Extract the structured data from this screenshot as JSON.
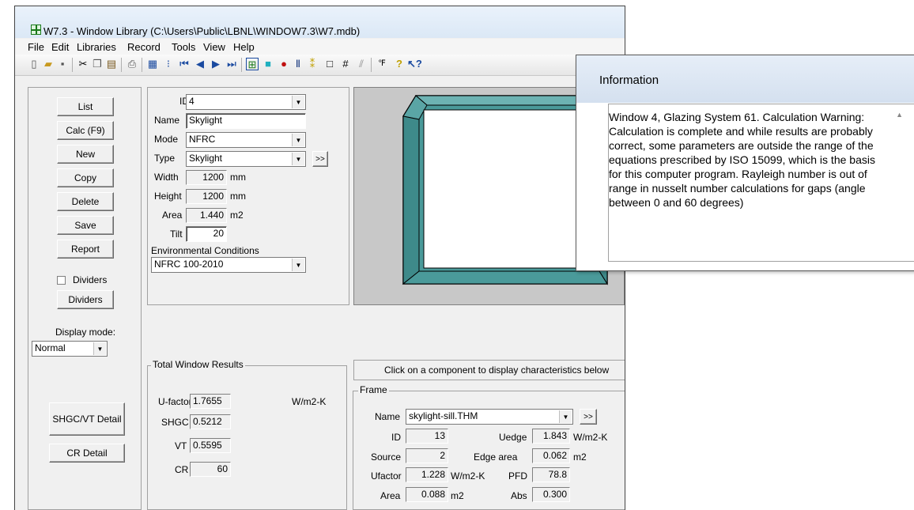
{
  "app": {
    "title": "W7.3 - Window Library (C:\\Users\\Public\\LBNL\\WINDOW7.3\\W7.mdb)",
    "menu": [
      "File",
      "Edit",
      "Libraries",
      "Record",
      "Tools",
      "View",
      "Help"
    ]
  },
  "toolbar": {
    "icons": [
      "new-file-icon",
      "open-folder-icon",
      "save-disk-icon",
      "cut-icon",
      "copy-icon",
      "paste-icon",
      "print-icon",
      "grid-view-icon",
      "list-view-icon",
      "first-record-icon",
      "previous-record-icon",
      "next-record-icon",
      "last-record-icon",
      "window-icon",
      "glazing-icon",
      "gas-icon",
      "frame-icon",
      "spacer-icon",
      "divider-icon",
      "grid-icon",
      "shading-icon",
      "units-icon",
      "help-icon",
      "context-help-icon"
    ]
  },
  "buttons": {
    "list": "List",
    "calc": "Calc (F9)",
    "new": "New",
    "copy": "Copy",
    "delete": "Delete",
    "save": "Save",
    "report": "Report",
    "dividers_check": "Dividers",
    "dividers": "Dividers",
    "shgc_vt_detail": "SHGC/VT Detail",
    "cr_detail": "CR Detail",
    "type_more": ">>",
    "frame_more": ">>"
  },
  "display_mode": {
    "label": "Display mode:",
    "value": "Normal"
  },
  "record": {
    "id_label": "ID #",
    "id": "4",
    "name_label": "Name",
    "name": "Skylight",
    "mode_label": "Mode",
    "mode": "NFRC",
    "type_label": "Type",
    "type": "Skylight",
    "width_label": "Width",
    "width": "1200",
    "width_unit": "mm",
    "height_label": "Height",
    "height": "1200",
    "height_unit": "mm",
    "area_label": "Area",
    "area": "1.440",
    "area_unit": "m2",
    "tilt_label": "Tilt",
    "tilt": "20",
    "env_label": "Environmental Conditions",
    "env": "NFRC 100-2010"
  },
  "results": {
    "title": "Total Window Results",
    "ufactor_label": "U-factor",
    "ufactor": "1.7655",
    "ufactor_unit": "W/m2-K",
    "shgc_label": "SHGC",
    "shgc": "0.5212",
    "vt_label": "VT",
    "vt": "0.5595",
    "cr_label": "CR",
    "cr": "60"
  },
  "component_hint": "Click on a component to display characteristics below",
  "frame": {
    "title": "Frame",
    "name_label": "Name",
    "name": "skylight-sill.THM",
    "id_label": "ID",
    "id": "13",
    "uedge_label": "Uedge",
    "uedge": "1.843",
    "uedge_unit": "W/m2-K",
    "source_label": "Source",
    "source": "2",
    "edge_area_label": "Edge area",
    "edge_area": "0.062",
    "edge_area_unit": "m2",
    "ufactor_label": "Ufactor",
    "ufactor": "1.228",
    "ufactor_unit": "W/m2-K",
    "pfd_label": "PFD",
    "pfd": "78.8",
    "area_label": "Area",
    "area": "0.088",
    "area_unit": "m2",
    "abs_label": "Abs",
    "abs": "0.300"
  },
  "info_dialog": {
    "title": "Information",
    "message": "Window 4, Glazing System 61. Calculation Warning: Calculation is complete and while results are probably correct, some parameters are outside the range of the equations prescribed by ISO 15099, which is the basis for this computer program. Rayleigh number is out of range in nusselt number calculations for gaps (angle between 0 and 60 degrees)"
  },
  "colors": {
    "frame_teal": "#4a9a9a",
    "title_gradient": "#dbe8f6",
    "preview_bg": "#c8c8c8"
  }
}
